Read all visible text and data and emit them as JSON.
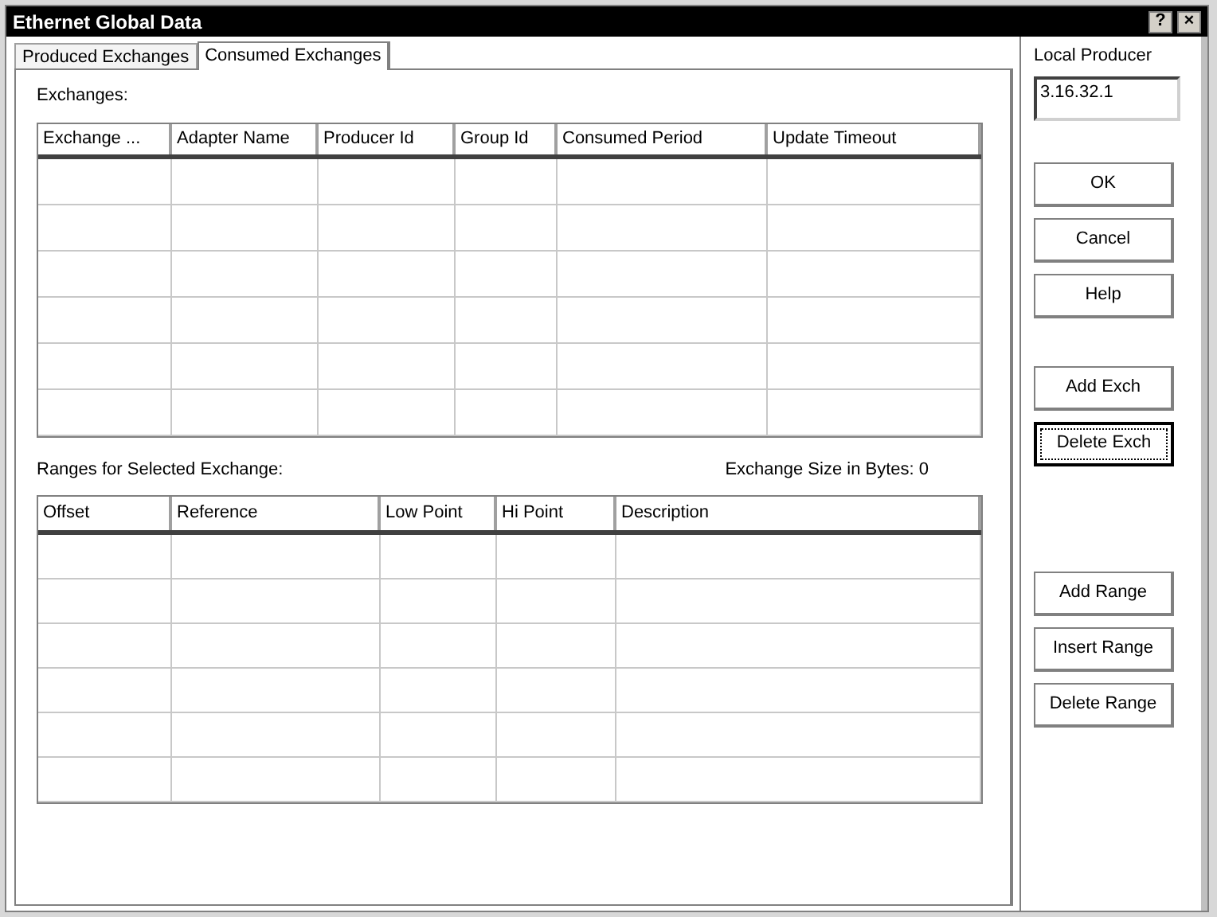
{
  "window": {
    "title": "Ethernet Global Data",
    "controls": [
      "?",
      "×"
    ]
  },
  "tabs": [
    {
      "label": "Produced Exchanges",
      "selected": false
    },
    {
      "label": "Consumed Exchanges",
      "selected": true
    }
  ],
  "exchanges": {
    "label": "Exchanges:",
    "columns": [
      "Exchange ...",
      "Adapter Name",
      "Producer Id",
      "Group Id",
      "Consumed Period",
      "Update Timeout"
    ]
  },
  "ranges": {
    "label": "Ranges for Selected Exchange:",
    "size_label": "Exchange Size in Bytes: 0",
    "columns": [
      "Offset",
      "Reference",
      "Low Point",
      "Hi Point",
      "Description"
    ]
  },
  "local_producer": {
    "label": "Local Producer",
    "value": "3.16.32.1"
  },
  "dialog_buttons": [
    {
      "label": "OK",
      "focused": false
    },
    {
      "label": "Cancel",
      "focused": false
    },
    {
      "label": "Help",
      "focused": false
    }
  ],
  "exchange_buttons": [
    {
      "label": "Add Exch",
      "focused": false
    },
    {
      "label": "Delete Exch",
      "focused": true
    }
  ],
  "range_buttons": [
    {
      "label": "Add Range",
      "focused": false
    },
    {
      "label": "Insert Range",
      "focused": false
    },
    {
      "label": "Delete Range",
      "focused": false
    }
  ]
}
